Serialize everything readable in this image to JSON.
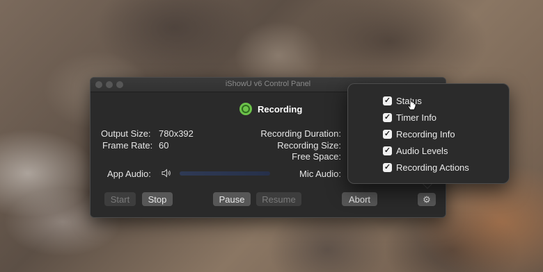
{
  "window": {
    "title": "iShowU v6 Control Panel"
  },
  "status": {
    "label": "Recording",
    "color": "#6cc24a"
  },
  "info": {
    "output_size_label": "Output Size:",
    "output_size_value": "780x392",
    "frame_rate_label": "Frame Rate:",
    "frame_rate_value": "60",
    "recording_duration_label": "Recording Duration:",
    "recording_size_label": "Recording Size:",
    "free_space_label": "Free Space:",
    "app_audio_label": "App Audio:",
    "mic_audio_label": "Mic Audio:"
  },
  "buttons": {
    "start": "Start",
    "stop": "Stop",
    "pause": "Pause",
    "resume": "Resume",
    "abort": "Abort"
  },
  "popover": {
    "options": [
      {
        "label": "Status",
        "checked": true
      },
      {
        "label": "Timer Info",
        "checked": true
      },
      {
        "label": "Recording Info",
        "checked": true
      },
      {
        "label": "Audio Levels",
        "checked": true
      },
      {
        "label": "Recording Actions",
        "checked": true
      }
    ]
  },
  "icons": {
    "speaker": "speaker-icon",
    "gear": "gear-icon",
    "check": "checkmark-icon"
  }
}
